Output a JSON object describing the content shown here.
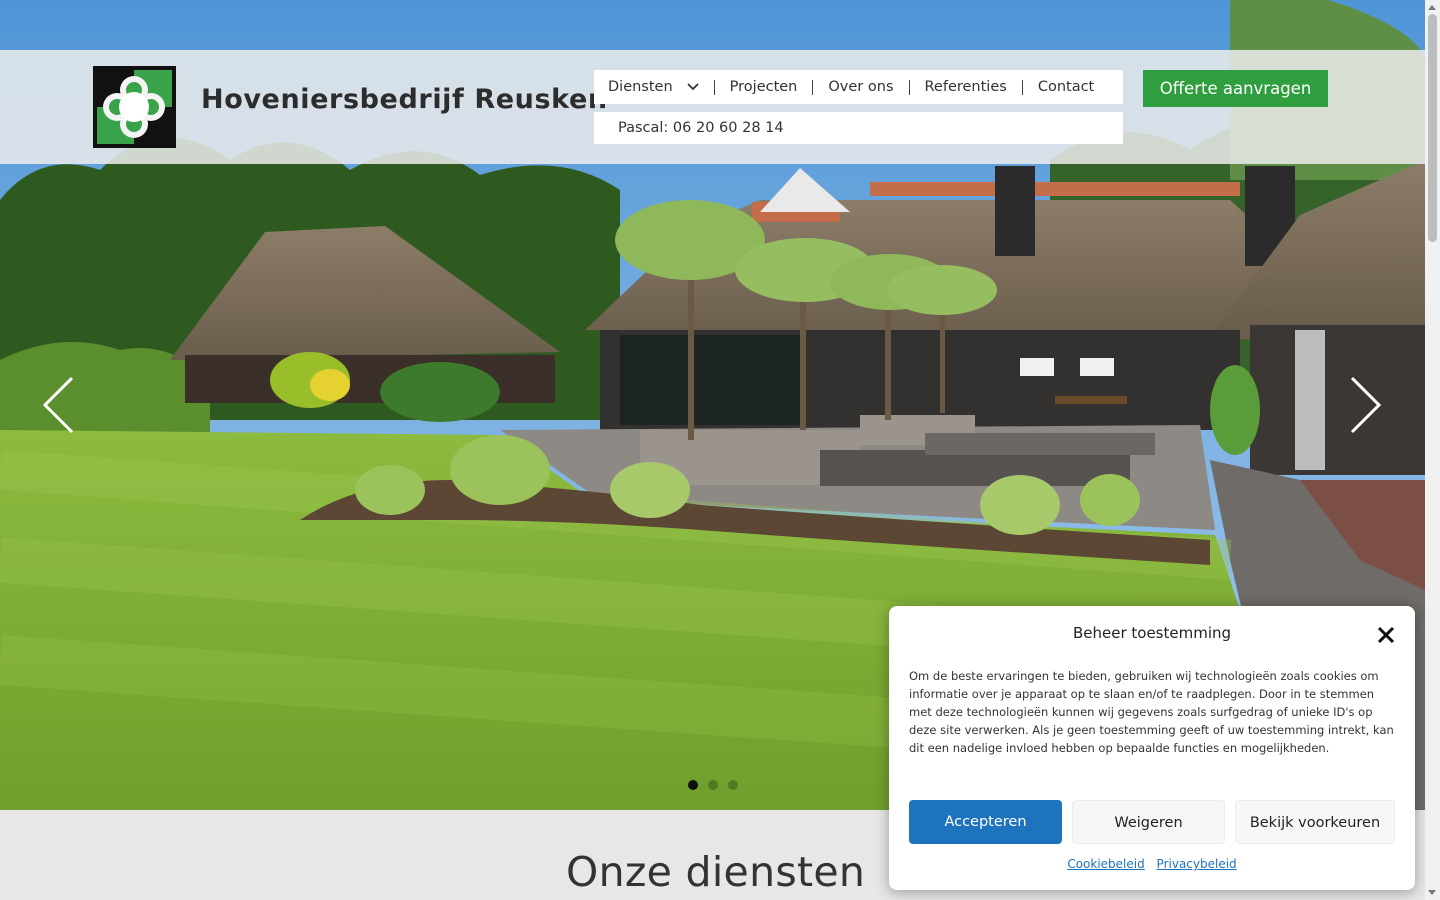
{
  "header": {
    "brand_name": "Hoveniersbedrijf Reusken",
    "nav": {
      "items": [
        {
          "label": "Diensten",
          "has_dropdown": true
        },
        {
          "label": "Projecten"
        },
        {
          "label": "Over ons"
        },
        {
          "label": "Referenties"
        },
        {
          "label": "Contact"
        }
      ]
    },
    "phone": "Pascal: 06 20 60 28 14",
    "cta_label": "Offerte aanvragen"
  },
  "carousel": {
    "slide_count": 3,
    "active_slide": 1,
    "prev_icon": "chevron-left-icon",
    "next_icon": "chevron-right-icon"
  },
  "section": {
    "title": "Onze diensten"
  },
  "consent": {
    "title": "Beheer toestemming",
    "body": "Om de beste ervaringen te bieden, gebruiken wij technologieën zoals cookies om informatie over je apparaat op te slaan en/of te raadplegen. Door in te stemmen met deze technologieën kunnen wij gegevens zoals surfgedrag of unieke ID's op deze site verwerken. Als je geen toestemming geeft of uw toestemming intrekt, kan dit een nadelige invloed hebben op bepaalde functies en mogelijkheden.",
    "accept_label": "Accepteren",
    "deny_label": "Weigeren",
    "preferences_label": "Bekijk voorkeuren",
    "cookie_policy_label": "Cookiebeleid",
    "privacy_policy_label": "Privacybeleid"
  },
  "colors": {
    "cta_green": "#2e9e3e",
    "accept_blue": "#1e73be",
    "logo_green": "#3aa34a",
    "lawn_green": "#7cae35"
  }
}
